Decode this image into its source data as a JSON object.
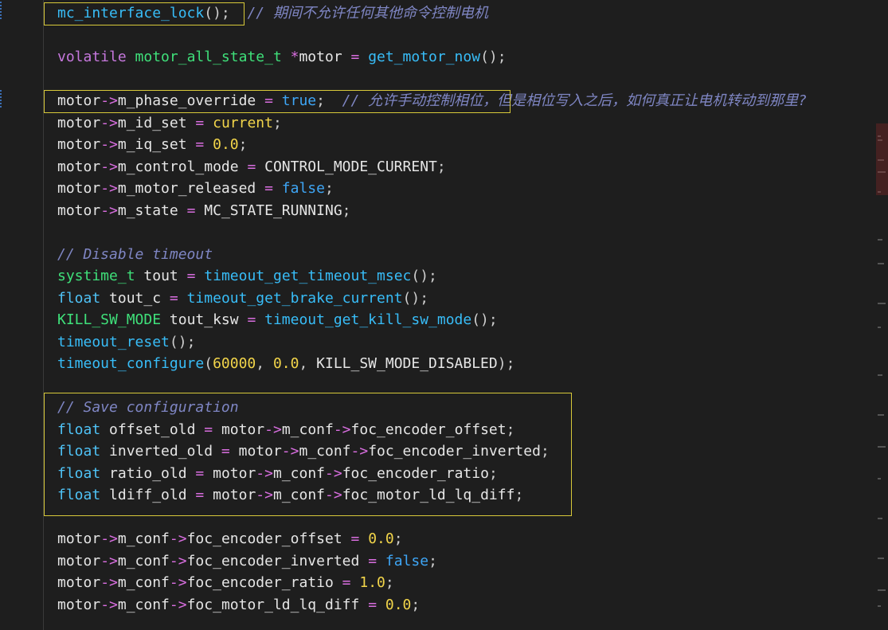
{
  "lines": [
    {
      "tokens": [
        {
          "c": "fn",
          "t": "mc_interface_lock"
        },
        {
          "c": "p",
          "t": "();"
        },
        {
          "c": "p",
          "t": "  "
        },
        {
          "c": "cm",
          "t": "// 期间不允许任何其他命令控制电机"
        }
      ]
    },
    {
      "tokens": []
    },
    {
      "tokens": [
        {
          "c": "kw",
          "t": "volatile"
        },
        {
          "c": "p",
          "t": " "
        },
        {
          "c": "green",
          "t": "motor_all_state_t"
        },
        {
          "c": "p",
          "t": " "
        },
        {
          "c": "op",
          "t": "*"
        },
        {
          "c": "var",
          "t": "motor"
        },
        {
          "c": "p",
          "t": " "
        },
        {
          "c": "op",
          "t": "="
        },
        {
          "c": "p",
          "t": " "
        },
        {
          "c": "fn",
          "t": "get_motor_now"
        },
        {
          "c": "p",
          "t": "();"
        }
      ]
    },
    {
      "tokens": []
    },
    {
      "tokens": [
        {
          "c": "var",
          "t": "motor"
        },
        {
          "c": "op",
          "t": "->"
        },
        {
          "c": "var",
          "t": "m_phase_override"
        },
        {
          "c": "p",
          "t": " "
        },
        {
          "c": "op",
          "t": "="
        },
        {
          "c": "p",
          "t": " "
        },
        {
          "c": "bool",
          "t": "true"
        },
        {
          "c": "p",
          "t": ";  "
        },
        {
          "c": "cm",
          "t": "// 允许手动控制相位，但是相位写入之后，如何真正让电机转动到那里?"
        }
      ]
    },
    {
      "tokens": [
        {
          "c": "var",
          "t": "motor"
        },
        {
          "c": "op",
          "t": "->"
        },
        {
          "c": "var",
          "t": "m_id_set"
        },
        {
          "c": "p",
          "t": " "
        },
        {
          "c": "op",
          "t": "="
        },
        {
          "c": "p",
          "t": " "
        },
        {
          "c": "num",
          "t": "current"
        },
        {
          "c": "p",
          "t": ";"
        }
      ]
    },
    {
      "tokens": [
        {
          "c": "var",
          "t": "motor"
        },
        {
          "c": "op",
          "t": "->"
        },
        {
          "c": "var",
          "t": "m_iq_set"
        },
        {
          "c": "p",
          "t": " "
        },
        {
          "c": "op",
          "t": "="
        },
        {
          "c": "p",
          "t": " "
        },
        {
          "c": "num",
          "t": "0.0"
        },
        {
          "c": "p",
          "t": ";"
        }
      ]
    },
    {
      "tokens": [
        {
          "c": "var",
          "t": "motor"
        },
        {
          "c": "op",
          "t": "->"
        },
        {
          "c": "var",
          "t": "m_control_mode"
        },
        {
          "c": "p",
          "t": " "
        },
        {
          "c": "op",
          "t": "="
        },
        {
          "c": "p",
          "t": " "
        },
        {
          "c": "cst",
          "t": "CONTROL_MODE_CURRENT"
        },
        {
          "c": "p",
          "t": ";"
        }
      ]
    },
    {
      "tokens": [
        {
          "c": "var",
          "t": "motor"
        },
        {
          "c": "op",
          "t": "->"
        },
        {
          "c": "var",
          "t": "m_motor_released"
        },
        {
          "c": "p",
          "t": " "
        },
        {
          "c": "op",
          "t": "="
        },
        {
          "c": "p",
          "t": " "
        },
        {
          "c": "bool",
          "t": "false"
        },
        {
          "c": "p",
          "t": ";"
        }
      ]
    },
    {
      "tokens": [
        {
          "c": "var",
          "t": "motor"
        },
        {
          "c": "op",
          "t": "->"
        },
        {
          "c": "var",
          "t": "m_state"
        },
        {
          "c": "p",
          "t": " "
        },
        {
          "c": "op",
          "t": "="
        },
        {
          "c": "p",
          "t": " "
        },
        {
          "c": "cst",
          "t": "MC_STATE_RUNNING"
        },
        {
          "c": "p",
          "t": ";"
        }
      ]
    },
    {
      "tokens": []
    },
    {
      "tokens": [
        {
          "c": "cm",
          "t": "// Disable timeout"
        }
      ]
    },
    {
      "tokens": [
        {
          "c": "green",
          "t": "systime_t"
        },
        {
          "c": "p",
          "t": " "
        },
        {
          "c": "var",
          "t": "tout"
        },
        {
          "c": "p",
          "t": " "
        },
        {
          "c": "op",
          "t": "="
        },
        {
          "c": "p",
          "t": " "
        },
        {
          "c": "fn",
          "t": "timeout_get_timeout_msec"
        },
        {
          "c": "p",
          "t": "();"
        }
      ]
    },
    {
      "tokens": [
        {
          "c": "kwTy",
          "t": "float"
        },
        {
          "c": "p",
          "t": " "
        },
        {
          "c": "var",
          "t": "tout_c"
        },
        {
          "c": "p",
          "t": " "
        },
        {
          "c": "op",
          "t": "="
        },
        {
          "c": "p",
          "t": " "
        },
        {
          "c": "fn",
          "t": "timeout_get_brake_current"
        },
        {
          "c": "p",
          "t": "();"
        }
      ]
    },
    {
      "tokens": [
        {
          "c": "green",
          "t": "KILL_SW_MODE"
        },
        {
          "c": "p",
          "t": " "
        },
        {
          "c": "var",
          "t": "tout_ksw"
        },
        {
          "c": "p",
          "t": " "
        },
        {
          "c": "op",
          "t": "="
        },
        {
          "c": "p",
          "t": " "
        },
        {
          "c": "fn",
          "t": "timeout_get_kill_sw_mode"
        },
        {
          "c": "p",
          "t": "();"
        }
      ]
    },
    {
      "tokens": [
        {
          "c": "fn",
          "t": "timeout_reset"
        },
        {
          "c": "p",
          "t": "();"
        }
      ]
    },
    {
      "tokens": [
        {
          "c": "fn",
          "t": "timeout_configure"
        },
        {
          "c": "p",
          "t": "("
        },
        {
          "c": "num",
          "t": "60000"
        },
        {
          "c": "p",
          "t": ", "
        },
        {
          "c": "num",
          "t": "0.0"
        },
        {
          "c": "p",
          "t": ", "
        },
        {
          "c": "cst",
          "t": "KILL_SW_MODE_DISABLED"
        },
        {
          "c": "p",
          "t": ");"
        }
      ]
    },
    {
      "tokens": []
    },
    {
      "tokens": [
        {
          "c": "cm",
          "t": "// Save configuration"
        }
      ]
    },
    {
      "tokens": [
        {
          "c": "kwTy",
          "t": "float"
        },
        {
          "c": "p",
          "t": " "
        },
        {
          "c": "var",
          "t": "offset_old"
        },
        {
          "c": "p",
          "t": " "
        },
        {
          "c": "op",
          "t": "="
        },
        {
          "c": "p",
          "t": " "
        },
        {
          "c": "var",
          "t": "motor"
        },
        {
          "c": "op",
          "t": "->"
        },
        {
          "c": "var",
          "t": "m_conf"
        },
        {
          "c": "op",
          "t": "->"
        },
        {
          "c": "var",
          "t": "foc_encoder_offset"
        },
        {
          "c": "p",
          "t": ";"
        }
      ]
    },
    {
      "tokens": [
        {
          "c": "kwTy",
          "t": "float"
        },
        {
          "c": "p",
          "t": " "
        },
        {
          "c": "var",
          "t": "inverted_old"
        },
        {
          "c": "p",
          "t": " "
        },
        {
          "c": "op",
          "t": "="
        },
        {
          "c": "p",
          "t": " "
        },
        {
          "c": "var",
          "t": "motor"
        },
        {
          "c": "op",
          "t": "->"
        },
        {
          "c": "var",
          "t": "m_conf"
        },
        {
          "c": "op",
          "t": "->"
        },
        {
          "c": "var",
          "t": "foc_encoder_inverted"
        },
        {
          "c": "p",
          "t": ";"
        }
      ]
    },
    {
      "tokens": [
        {
          "c": "kwTy",
          "t": "float"
        },
        {
          "c": "p",
          "t": " "
        },
        {
          "c": "var",
          "t": "ratio_old"
        },
        {
          "c": "p",
          "t": " "
        },
        {
          "c": "op",
          "t": "="
        },
        {
          "c": "p",
          "t": " "
        },
        {
          "c": "var",
          "t": "motor"
        },
        {
          "c": "op",
          "t": "->"
        },
        {
          "c": "var",
          "t": "m_conf"
        },
        {
          "c": "op",
          "t": "->"
        },
        {
          "c": "var",
          "t": "foc_encoder_ratio"
        },
        {
          "c": "p",
          "t": ";"
        }
      ]
    },
    {
      "tokens": [
        {
          "c": "kwTy",
          "t": "float"
        },
        {
          "c": "p",
          "t": " "
        },
        {
          "c": "var",
          "t": "ldiff_old"
        },
        {
          "c": "p",
          "t": " "
        },
        {
          "c": "op",
          "t": "="
        },
        {
          "c": "p",
          "t": " "
        },
        {
          "c": "var",
          "t": "motor"
        },
        {
          "c": "op",
          "t": "->"
        },
        {
          "c": "var",
          "t": "m_conf"
        },
        {
          "c": "op",
          "t": "->"
        },
        {
          "c": "var",
          "t": "foc_motor_ld_lq_diff"
        },
        {
          "c": "p",
          "t": ";"
        }
      ]
    },
    {
      "tokens": []
    },
    {
      "tokens": [
        {
          "c": "var",
          "t": "motor"
        },
        {
          "c": "op",
          "t": "->"
        },
        {
          "c": "var",
          "t": "m_conf"
        },
        {
          "c": "op",
          "t": "->"
        },
        {
          "c": "var",
          "t": "foc_encoder_offset"
        },
        {
          "c": "p",
          "t": " "
        },
        {
          "c": "op",
          "t": "="
        },
        {
          "c": "p",
          "t": " "
        },
        {
          "c": "num",
          "t": "0.0"
        },
        {
          "c": "p",
          "t": ";"
        }
      ]
    },
    {
      "tokens": [
        {
          "c": "var",
          "t": "motor"
        },
        {
          "c": "op",
          "t": "->"
        },
        {
          "c": "var",
          "t": "m_conf"
        },
        {
          "c": "op",
          "t": "->"
        },
        {
          "c": "var",
          "t": "foc_encoder_inverted"
        },
        {
          "c": "p",
          "t": " "
        },
        {
          "c": "op",
          "t": "="
        },
        {
          "c": "p",
          "t": " "
        },
        {
          "c": "bool",
          "t": "false"
        },
        {
          "c": "p",
          "t": ";"
        }
      ]
    },
    {
      "tokens": [
        {
          "c": "var",
          "t": "motor"
        },
        {
          "c": "op",
          "t": "->"
        },
        {
          "c": "var",
          "t": "m_conf"
        },
        {
          "c": "op",
          "t": "->"
        },
        {
          "c": "var",
          "t": "foc_encoder_ratio"
        },
        {
          "c": "p",
          "t": " "
        },
        {
          "c": "op",
          "t": "="
        },
        {
          "c": "p",
          "t": " "
        },
        {
          "c": "num",
          "t": "1.0"
        },
        {
          "c": "p",
          "t": ";"
        }
      ]
    },
    {
      "tokens": [
        {
          "c": "var",
          "t": "motor"
        },
        {
          "c": "op",
          "t": "->"
        },
        {
          "c": "var",
          "t": "m_conf"
        },
        {
          "c": "op",
          "t": "->"
        },
        {
          "c": "var",
          "t": "foc_motor_ld_lq_diff"
        },
        {
          "c": "p",
          "t": " "
        },
        {
          "c": "op",
          "t": "="
        },
        {
          "c": "p",
          "t": " "
        },
        {
          "c": "num",
          "t": "0.0"
        },
        {
          "c": "p",
          "t": ";"
        }
      ]
    }
  ],
  "colors": {
    "background": "#1e1e1e",
    "highlight_box": "#d8c93a",
    "comment": "#7f86c4",
    "function": "#38bdf8",
    "number": "#f2d54a",
    "keyword": "#c678dd"
  }
}
